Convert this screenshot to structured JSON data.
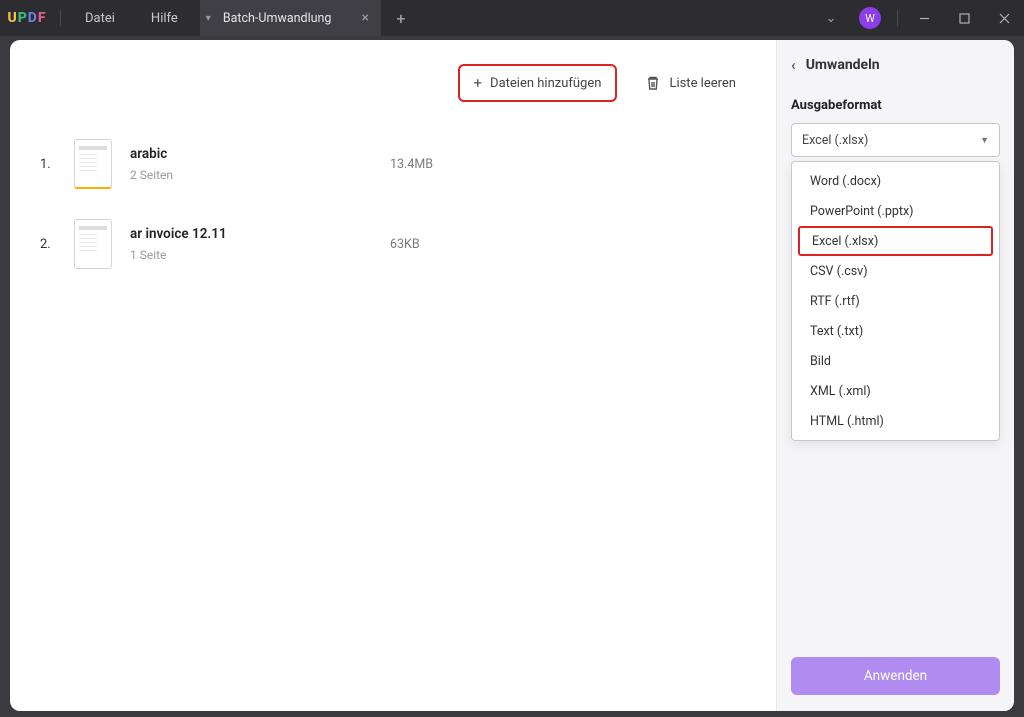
{
  "titlebar": {
    "menu": {
      "file": "Datei",
      "help": "Hilfe"
    },
    "tab": {
      "label": "Batch-Umwandlung"
    },
    "avatar_letter": "W"
  },
  "toolbar": {
    "add_files": "Dateien hinzufügen",
    "clear_list": "Liste leeren"
  },
  "files": [
    {
      "idx": "1.",
      "name": "arabic",
      "pages": "2 Seiten",
      "size": "13.4MB"
    },
    {
      "idx": "2.",
      "name": "ar invoice 12.11",
      "pages": "1 Seite",
      "size": "63KB"
    }
  ],
  "sidebar": {
    "title": "Umwandeln",
    "format_label": "Ausgabeformat",
    "selected": "Excel (.xlsx)",
    "options": [
      "Word (.docx)",
      "PowerPoint (.pptx)",
      "Excel (.xlsx)",
      "CSV (.csv)",
      "RTF (.rtf)",
      "Text (.txt)",
      "Bild",
      "XML (.xml)",
      "HTML (.html)"
    ],
    "highlighted_option": "Excel (.xlsx)",
    "apply": "Anwenden"
  }
}
